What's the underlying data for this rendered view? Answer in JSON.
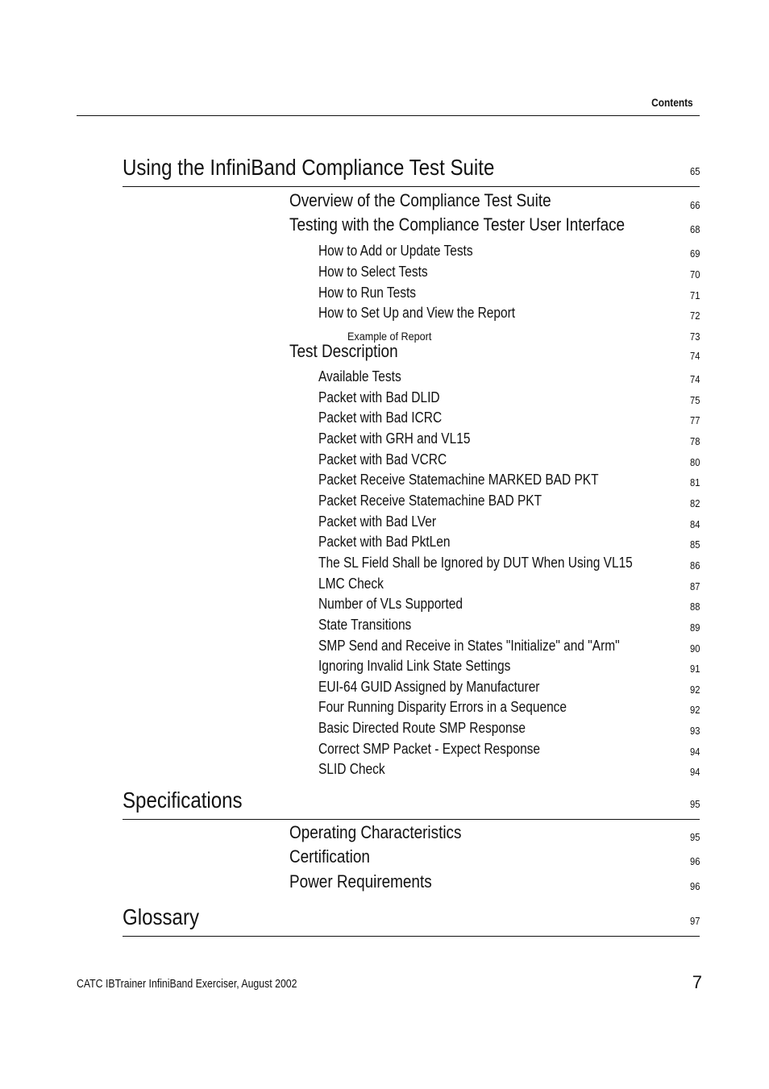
{
  "header": {
    "running_head": "Contents"
  },
  "toc": {
    "chapters": [
      {
        "title": "Using the InfiniBand Compliance Test Suite",
        "page": "65",
        "entries": [
          {
            "level": 1,
            "label": "Overview of the Compliance Test Suite",
            "page": "66"
          },
          {
            "level": 1,
            "label": "Testing with the Compliance Tester User Interface",
            "page": "68"
          },
          {
            "level": 2,
            "label": "How to Add or Update Tests",
            "page": "69"
          },
          {
            "level": 2,
            "label": "How to Select Tests",
            "page": "70"
          },
          {
            "level": 2,
            "label": "How to Run Tests",
            "page": "71"
          },
          {
            "level": 2,
            "label": "How to Set Up and View the Report",
            "page": "72"
          },
          {
            "level": 3,
            "label": "Example of Report",
            "page": "73"
          },
          {
            "level": 1,
            "label": "Test Description",
            "page": "74"
          },
          {
            "level": 2,
            "label": "Available Tests",
            "page": "74"
          },
          {
            "level": 2,
            "label": "Packet with Bad DLID",
            "page": "75"
          },
          {
            "level": 2,
            "label": "Packet with Bad ICRC",
            "page": "77"
          },
          {
            "level": 2,
            "label": "Packet with GRH and VL15",
            "page": "78"
          },
          {
            "level": 2,
            "label": "Packet with Bad VCRC",
            "page": "80"
          },
          {
            "level": 2,
            "label": "Packet Receive Statemachine MARKED BAD PKT",
            "page": "81"
          },
          {
            "level": 2,
            "label": "Packet Receive Statemachine BAD PKT",
            "page": "82"
          },
          {
            "level": 2,
            "label": "Packet with Bad LVer",
            "page": "84"
          },
          {
            "level": 2,
            "label": "Packet with Bad PktLen",
            "page": "85"
          },
          {
            "level": 2,
            "label": "The SL Field Shall be Ignored by DUT When Using VL15",
            "page": "86"
          },
          {
            "level": 2,
            "label": "LMC Check",
            "page": "87"
          },
          {
            "level": 2,
            "label": "Number of VLs Supported",
            "page": "88"
          },
          {
            "level": 2,
            "label": "State Transitions",
            "page": "89"
          },
          {
            "level": 2,
            "label": "SMP Send and Receive in States \"Initialize\" and \"Arm\"",
            "page": "90"
          },
          {
            "level": 2,
            "label": "Ignoring Invalid Link State Settings",
            "page": "91"
          },
          {
            "level": 2,
            "label": "EUI-64 GUID Assigned by Manufacturer",
            "page": "92"
          },
          {
            "level": 2,
            "label": "Four Running Disparity Errors in a Sequence",
            "page": "92"
          },
          {
            "level": 2,
            "label": "Basic Directed Route SMP Response",
            "page": "93"
          },
          {
            "level": 2,
            "label": "Correct SMP Packet - Expect Response",
            "page": "94"
          },
          {
            "level": 2,
            "label": "SLID Check",
            "page": "94"
          }
        ]
      },
      {
        "title": "Specifications",
        "page": "95",
        "entries": [
          {
            "level": 1,
            "label": "Operating Characteristics",
            "page": "95"
          },
          {
            "level": 1,
            "label": "Certification",
            "page": "96"
          },
          {
            "level": 1,
            "label": "Power Requirements",
            "page": "96"
          }
        ]
      },
      {
        "title": "Glossary",
        "page": "97",
        "entries": []
      }
    ]
  },
  "footer": {
    "text": "CATC IBTrainer InfiniBand Exerciser, August 2002",
    "page_number": "7"
  }
}
